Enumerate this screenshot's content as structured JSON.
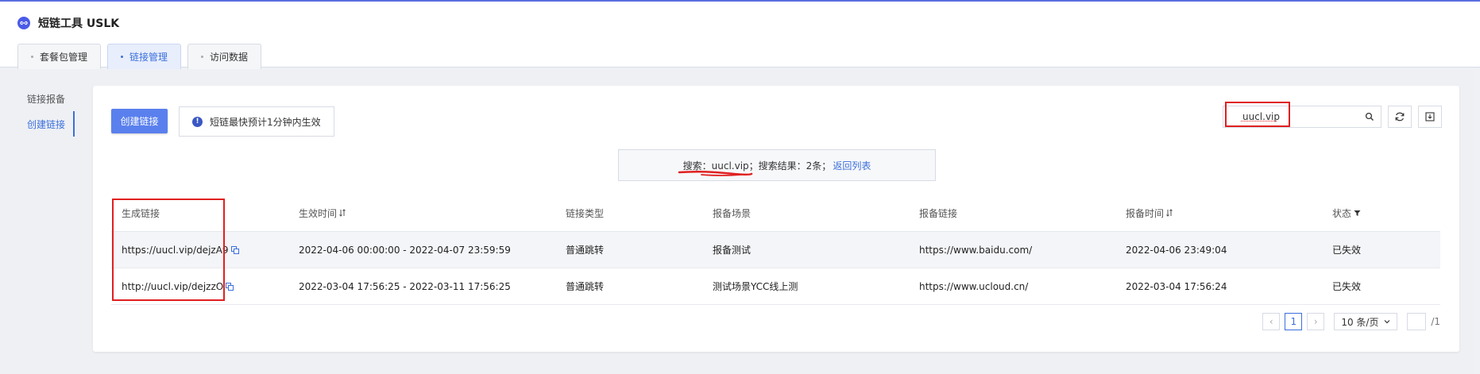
{
  "app": {
    "title": "短链工具 USLK",
    "logo_icon": "link-icon"
  },
  "tabs": [
    {
      "label": "套餐包管理",
      "active": false
    },
    {
      "label": "链接管理",
      "active": true
    },
    {
      "label": "访问数据",
      "active": false
    }
  ],
  "sidebar": {
    "items": [
      {
        "label": "链接报备",
        "active": false
      },
      {
        "label": "创建链接",
        "active": true
      }
    ]
  },
  "toolbar": {
    "create_label": "创建链接",
    "notice_text": "短链最快预计1分钟内生效",
    "search_value": "uucl.vip",
    "search_icon": "magnifier-icon",
    "refresh_icon": "refresh-icon",
    "download_icon": "download-icon"
  },
  "search_result": {
    "text": "搜索：uucl.vip；搜索结果：2条；",
    "back_label": "返回列表"
  },
  "table": {
    "headers": [
      "生成链接",
      "生效时间",
      "链接类型",
      "报备场景",
      "报备链接",
      "报备时间",
      "状态"
    ],
    "rows": [
      [
        "https://uucl.vip/dejzA9",
        "2022-04-06 00:00:00 - 2022-04-07 23:59:59",
        "普通跳转",
        "报备测试",
        "https://www.baidu.com/",
        "2022-04-06 23:49:04",
        "已失效"
      ],
      [
        "http://uucl.vip/dejzzO",
        "2022-03-04 17:56:25 - 2022-03-11 17:56:25",
        "普通跳转",
        "测试场景YCC线上测",
        "https://www.ucloud.cn/",
        "2022-03-04 17:56:24",
        "已失效"
      ]
    ]
  },
  "pagination": {
    "current_page": "1",
    "page_size": "10 条/页",
    "total_pages": "/1"
  },
  "colors": {
    "accent": "#3b6fdc",
    "primary_button": "#5a80ee",
    "annotation": "#e02020"
  }
}
